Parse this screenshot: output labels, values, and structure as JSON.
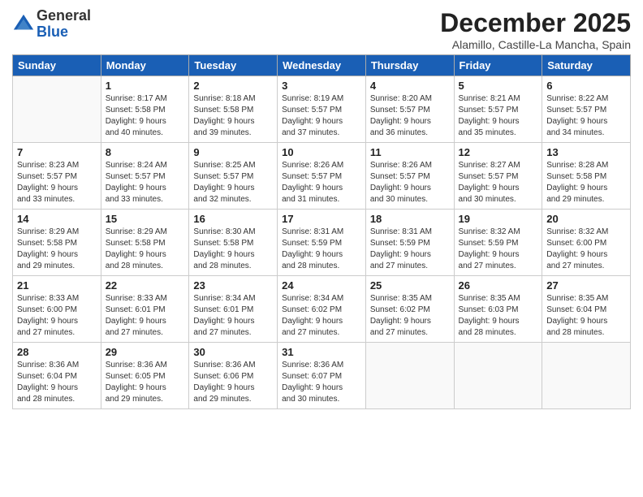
{
  "logo": {
    "general": "General",
    "blue": "Blue"
  },
  "title": "December 2025",
  "location": "Alamillo, Castille-La Mancha, Spain",
  "headers": [
    "Sunday",
    "Monday",
    "Tuesday",
    "Wednesday",
    "Thursday",
    "Friday",
    "Saturday"
  ],
  "weeks": [
    [
      {
        "day": "",
        "info": ""
      },
      {
        "day": "1",
        "info": "Sunrise: 8:17 AM\nSunset: 5:58 PM\nDaylight: 9 hours\nand 40 minutes."
      },
      {
        "day": "2",
        "info": "Sunrise: 8:18 AM\nSunset: 5:58 PM\nDaylight: 9 hours\nand 39 minutes."
      },
      {
        "day": "3",
        "info": "Sunrise: 8:19 AM\nSunset: 5:57 PM\nDaylight: 9 hours\nand 37 minutes."
      },
      {
        "day": "4",
        "info": "Sunrise: 8:20 AM\nSunset: 5:57 PM\nDaylight: 9 hours\nand 36 minutes."
      },
      {
        "day": "5",
        "info": "Sunrise: 8:21 AM\nSunset: 5:57 PM\nDaylight: 9 hours\nand 35 minutes."
      },
      {
        "day": "6",
        "info": "Sunrise: 8:22 AM\nSunset: 5:57 PM\nDaylight: 9 hours\nand 34 minutes."
      }
    ],
    [
      {
        "day": "7",
        "info": "Sunrise: 8:23 AM\nSunset: 5:57 PM\nDaylight: 9 hours\nand 33 minutes."
      },
      {
        "day": "8",
        "info": "Sunrise: 8:24 AM\nSunset: 5:57 PM\nDaylight: 9 hours\nand 33 minutes."
      },
      {
        "day": "9",
        "info": "Sunrise: 8:25 AM\nSunset: 5:57 PM\nDaylight: 9 hours\nand 32 minutes."
      },
      {
        "day": "10",
        "info": "Sunrise: 8:26 AM\nSunset: 5:57 PM\nDaylight: 9 hours\nand 31 minutes."
      },
      {
        "day": "11",
        "info": "Sunrise: 8:26 AM\nSunset: 5:57 PM\nDaylight: 9 hours\nand 30 minutes."
      },
      {
        "day": "12",
        "info": "Sunrise: 8:27 AM\nSunset: 5:57 PM\nDaylight: 9 hours\nand 30 minutes."
      },
      {
        "day": "13",
        "info": "Sunrise: 8:28 AM\nSunset: 5:58 PM\nDaylight: 9 hours\nand 29 minutes."
      }
    ],
    [
      {
        "day": "14",
        "info": "Sunrise: 8:29 AM\nSunset: 5:58 PM\nDaylight: 9 hours\nand 29 minutes."
      },
      {
        "day": "15",
        "info": "Sunrise: 8:29 AM\nSunset: 5:58 PM\nDaylight: 9 hours\nand 28 minutes."
      },
      {
        "day": "16",
        "info": "Sunrise: 8:30 AM\nSunset: 5:58 PM\nDaylight: 9 hours\nand 28 minutes."
      },
      {
        "day": "17",
        "info": "Sunrise: 8:31 AM\nSunset: 5:59 PM\nDaylight: 9 hours\nand 28 minutes."
      },
      {
        "day": "18",
        "info": "Sunrise: 8:31 AM\nSunset: 5:59 PM\nDaylight: 9 hours\nand 27 minutes."
      },
      {
        "day": "19",
        "info": "Sunrise: 8:32 AM\nSunset: 5:59 PM\nDaylight: 9 hours\nand 27 minutes."
      },
      {
        "day": "20",
        "info": "Sunrise: 8:32 AM\nSunset: 6:00 PM\nDaylight: 9 hours\nand 27 minutes."
      }
    ],
    [
      {
        "day": "21",
        "info": "Sunrise: 8:33 AM\nSunset: 6:00 PM\nDaylight: 9 hours\nand 27 minutes."
      },
      {
        "day": "22",
        "info": "Sunrise: 8:33 AM\nSunset: 6:01 PM\nDaylight: 9 hours\nand 27 minutes."
      },
      {
        "day": "23",
        "info": "Sunrise: 8:34 AM\nSunset: 6:01 PM\nDaylight: 9 hours\nand 27 minutes."
      },
      {
        "day": "24",
        "info": "Sunrise: 8:34 AM\nSunset: 6:02 PM\nDaylight: 9 hours\nand 27 minutes."
      },
      {
        "day": "25",
        "info": "Sunrise: 8:35 AM\nSunset: 6:02 PM\nDaylight: 9 hours\nand 27 minutes."
      },
      {
        "day": "26",
        "info": "Sunrise: 8:35 AM\nSunset: 6:03 PM\nDaylight: 9 hours\nand 28 minutes."
      },
      {
        "day": "27",
        "info": "Sunrise: 8:35 AM\nSunset: 6:04 PM\nDaylight: 9 hours\nand 28 minutes."
      }
    ],
    [
      {
        "day": "28",
        "info": "Sunrise: 8:36 AM\nSunset: 6:04 PM\nDaylight: 9 hours\nand 28 minutes."
      },
      {
        "day": "29",
        "info": "Sunrise: 8:36 AM\nSunset: 6:05 PM\nDaylight: 9 hours\nand 29 minutes."
      },
      {
        "day": "30",
        "info": "Sunrise: 8:36 AM\nSunset: 6:06 PM\nDaylight: 9 hours\nand 29 minutes."
      },
      {
        "day": "31",
        "info": "Sunrise: 8:36 AM\nSunset: 6:07 PM\nDaylight: 9 hours\nand 30 minutes."
      },
      {
        "day": "",
        "info": ""
      },
      {
        "day": "",
        "info": ""
      },
      {
        "day": "",
        "info": ""
      }
    ]
  ]
}
